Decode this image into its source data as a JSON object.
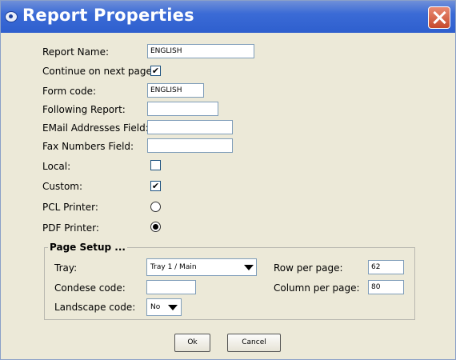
{
  "window": {
    "title": "Report Properties"
  },
  "fields": {
    "report_name": {
      "label": "Report Name:",
      "value": "ENGLISH"
    },
    "continue_next_page": {
      "label": "Continue on next page:",
      "checked": true
    },
    "form_code": {
      "label": "Form code:",
      "value": "ENGLISH"
    },
    "following_report": {
      "label": "Following Report:",
      "value": ""
    },
    "email_field": {
      "label": "EMail Addresses Field:",
      "value": ""
    },
    "fax_field": {
      "label": "Fax Numbers Field:",
      "value": ""
    },
    "local": {
      "label": "Local:",
      "checked": false
    },
    "custom": {
      "label": "Custom:",
      "checked": true
    },
    "pcl_printer": {
      "label": "PCL Printer:",
      "selected": false
    },
    "pdf_printer": {
      "label": "PDF Printer:",
      "selected": true
    }
  },
  "page_setup": {
    "title": "Page Setup ...",
    "tray": {
      "label": "Tray:",
      "value": "Tray 1 / Main"
    },
    "condese_code": {
      "label": "Condese code:",
      "value": ""
    },
    "landscape_code": {
      "label": "Landscape code:",
      "value": "No"
    },
    "row_per_page": {
      "label": "Row per page:",
      "value": "62"
    },
    "column_per_page": {
      "label": "Column per page:",
      "value": "80"
    }
  },
  "buttons": {
    "ok": "Ok",
    "cancel": "Cancel"
  },
  "check_glyph": "✔",
  "icons": {
    "app": "app-icon",
    "close": "close-icon",
    "dropdown": "chevron-down-icon"
  },
  "colors": {
    "titlebar": "#2e5fce",
    "window_bg": "#ece9d8",
    "close": "#c74a2c",
    "field_border": "#7f9db9"
  }
}
